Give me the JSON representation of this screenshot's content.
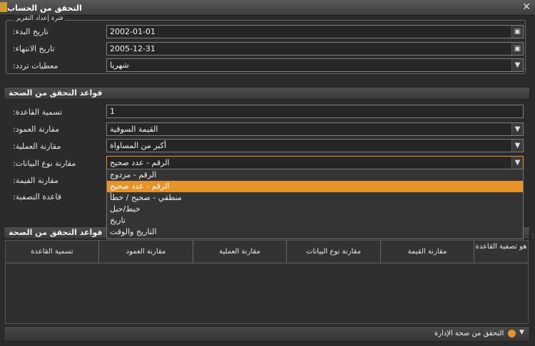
{
  "window": {
    "title": "التحقق من الحساب",
    "close": "✕"
  },
  "report_period": {
    "legend": "فترة إعداد التقرير",
    "start_label": ":تاريخ البدء",
    "start_value": "2002-01-01",
    "end_label": ":تاريخ الانتهاء",
    "end_value": "2005-12-31",
    "freq_label": ":معطيات تردد",
    "freq_value": "شهريا"
  },
  "validation_rules": {
    "header": "قواعد التحقق من الصحة",
    "rule_name_label": ":تسمية القاعدة",
    "rule_name_value": "1",
    "column_compare_label": ":مقارنة العمود",
    "column_compare_value": "القيمة السوقية",
    "op_compare_label": ":مقارنة العملية",
    "op_compare_value": "أكبر من المساواة",
    "datatype_compare_label": ":مقارنة نوع البيانات",
    "datatype_compare_value": "الرقم - عدد صحيح",
    "value_compare_label": ":مقارنة القيمة",
    "filter_rule_label": ":قاعدة التصفية"
  },
  "datatype_options": [
    "الرقم - مزدوج",
    "الرقم - عدد صحيح",
    "منطقي - صحيح / خطأ",
    "خيط/حبل",
    "تاريخ",
    "التاريخ والوقت"
  ],
  "rules_table": {
    "header": "قواعد التحقق من الصحة",
    "columns": [
      "تسمية القاعدة",
      "مقارنة العمود",
      "مقارنة العملية",
      "مقارنة نوع البيانات",
      "مقارنة القيمة",
      "هو تصفية القاعدة"
    ]
  },
  "footer": {
    "label": "التحقق من صحة الإدارة"
  },
  "colors": {
    "accent": "#e8922a",
    "background": "#2b2b2b"
  }
}
